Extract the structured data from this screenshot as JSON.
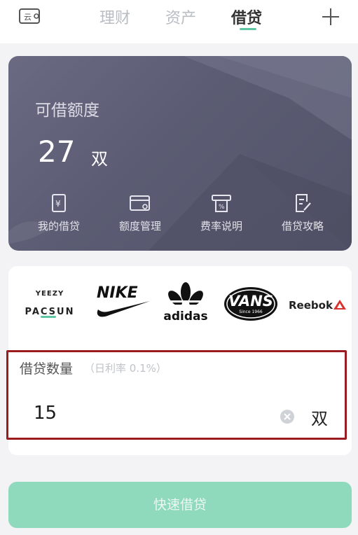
{
  "nav": {
    "tabs": [
      {
        "label": "理财"
      },
      {
        "label": "资产"
      },
      {
        "label": "借贷",
        "active": true
      }
    ],
    "left_icon_text": "云",
    "accent_color": "#5fc6a3"
  },
  "credit": {
    "title": "可借额度",
    "amount": "27",
    "unit": "双",
    "actions": [
      {
        "label": "我的借贷",
        "icon": "loan-doc-icon"
      },
      {
        "label": "额度管理",
        "icon": "card-manage-icon"
      },
      {
        "label": "费率说明",
        "icon": "rate-receipt-icon"
      },
      {
        "label": "借贷攻略",
        "icon": "guide-edit-icon"
      }
    ]
  },
  "brands": [
    {
      "line1": "YEEZY",
      "line2": "PACSUN",
      "selected": true
    },
    {
      "name": "NIKE"
    },
    {
      "name": "adidas"
    },
    {
      "name": "VANS",
      "sub": "Since 1966"
    },
    {
      "name": "Reebok"
    }
  ],
  "quantity": {
    "label": "借贷数量",
    "hint": "（日利率 0.1%）",
    "value": "15",
    "unit": "双"
  },
  "submit": {
    "label": "快速借贷"
  }
}
